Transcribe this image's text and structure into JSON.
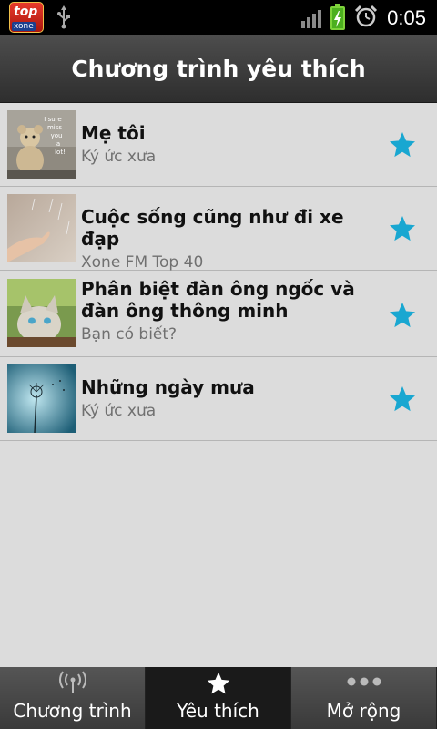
{
  "status_bar": {
    "app_icon_text": "top",
    "app_icon_sub": "xone",
    "time": "0:05"
  },
  "header": {
    "title": "Chương trình yêu thích"
  },
  "favorites": [
    {
      "title": "Mẹ tôi",
      "subtitle": "Ký ức xưa",
      "thumb_text": "I sure miss you a lot!",
      "starred": true
    },
    {
      "title": "Cuộc sống cũng như đi xe đạp",
      "subtitle": "Xone FM Top 40",
      "starred": true
    },
    {
      "title": "Phân biệt đàn ông ngốc và đàn ông thông minh",
      "subtitle": "Bạn có biết?",
      "starred": true
    },
    {
      "title": "Những ngày mưa",
      "subtitle": "Ký ức xưa",
      "starred": true
    }
  ],
  "tabs": [
    {
      "label": "Chương trình",
      "icon": "broadcast-icon",
      "active": false
    },
    {
      "label": "Yêu thích",
      "icon": "star-icon",
      "active": true
    },
    {
      "label": "Mở rộng",
      "icon": "more-dots-icon",
      "active": false
    }
  ],
  "colors": {
    "accent_star": "#19a7d1",
    "title_bar": "#3a3a3a",
    "list_bg": "#dcdcdc"
  }
}
